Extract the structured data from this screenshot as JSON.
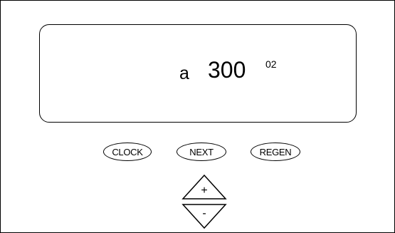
{
  "display": {
    "mode": "a",
    "value": "300",
    "sub": "02"
  },
  "buttons": {
    "clock": "CLOCK",
    "next": "NEXT",
    "regen": "REGEN",
    "up": "+",
    "down": "-"
  }
}
